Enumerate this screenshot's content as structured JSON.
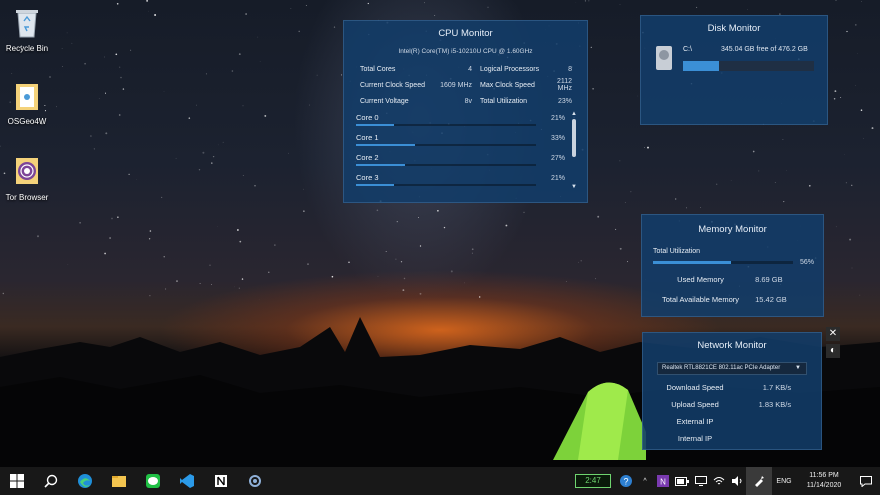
{
  "desktop": {
    "icons": [
      {
        "label": "Recycle Bin",
        "icon": "recycle-bin-icon"
      },
      {
        "label": "OSGeo4W",
        "icon": "folder-icon"
      },
      {
        "label": "Tor Browser",
        "icon": "tor-browser-icon"
      }
    ]
  },
  "cpu_monitor": {
    "title": "CPU Monitor",
    "model": "Intel(R) Core(TM) i5-10210U CPU @ 1.60GHz",
    "stats": [
      {
        "k1": "Total Cores",
        "v1": "4",
        "k2": "Logical Processors",
        "v2": "8"
      },
      {
        "k1": "Current Clock Speed",
        "v1": "1609 MHz",
        "k2": "Max Clock Speed",
        "v2": "2112 MHz"
      },
      {
        "k1": "Current Voltage",
        "v1": "8v",
        "k2": "Total Utilization",
        "v2": "23%"
      }
    ],
    "cores": [
      {
        "name": "Core 0",
        "pct_label": "21%",
        "value": 0.21
      },
      {
        "name": "Core 1",
        "pct_label": "33%",
        "value": 0.33
      },
      {
        "name": "Core 2",
        "pct_label": "27%",
        "value": 0.27
      },
      {
        "name": "Core 3",
        "pct_label": "21%",
        "value": 0.21
      }
    ]
  },
  "disk_monitor": {
    "title": "Disk Monitor",
    "drive": "C:\\",
    "free": "345.04 GB free of 476.2 GB",
    "used_fraction": 0.275
  },
  "memory_monitor": {
    "title": "Memory Monitor",
    "total_util_label": "Total Utilization",
    "total_util_pct": "56%",
    "util_value": 0.56,
    "used_label": "Used Memory",
    "used_value": "8.69 GB",
    "available_label": "Total Available Memory",
    "available_value": "15.42 GB"
  },
  "network_monitor": {
    "title": "Network Monitor",
    "adapter": "Realtek RTL8821CE 802.11ac PCIe Adapter",
    "download_label": "Download Speed",
    "download_value": "1.7 KB/s",
    "upload_label": "Upload Speed",
    "upload_value": "1.83 KB/s",
    "external_ip_label": "External IP",
    "internal_ip_label": "Internal IP"
  },
  "taskbar": {
    "apps": [
      "windows-start-icon",
      "search-icon",
      "edge-icon",
      "file-explorer-icon",
      "line-icon",
      "vscode-icon",
      "notion-icon",
      "app-icon"
    ],
    "timer": "2:47",
    "language": "ENG",
    "time": "11:56 PM",
    "date": "11/14/2020"
  },
  "colors": {
    "accent": "#3b8fd6",
    "panel": "#123c69",
    "timer_green": "#6fd46f"
  }
}
